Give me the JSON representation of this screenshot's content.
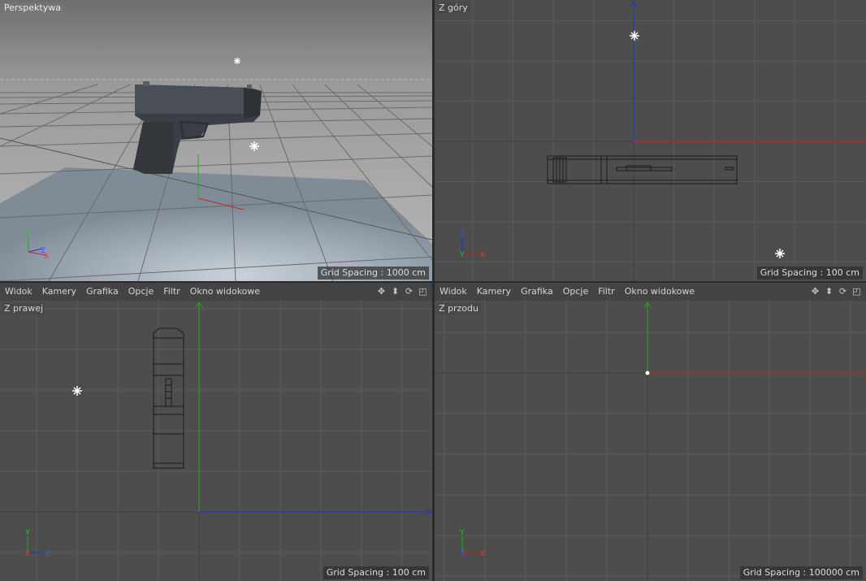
{
  "viewports": {
    "perspective": {
      "label": "Perspektywa",
      "grid_spacing": "Grid Spacing : 1000 cm"
    },
    "top": {
      "label": "Z góry",
      "grid_spacing": "Grid Spacing : 100 cm"
    },
    "right": {
      "label": "Z prawej",
      "grid_spacing": "Grid Spacing : 100 cm"
    },
    "front": {
      "label": "Z przodu",
      "grid_spacing": "Grid Spacing : 100000 cm"
    }
  },
  "menu": {
    "items": [
      "Widok",
      "Kamery",
      "Grafika",
      "Opcje",
      "Filtr",
      "Okno widokowe"
    ],
    "icons": [
      "move-icon",
      "zoom-icon",
      "rotate-icon",
      "maximize-icon"
    ]
  },
  "axis_labels": {
    "x": "X",
    "y": "Y",
    "z": "Z"
  },
  "colors": {
    "x_axis": "#cc2222",
    "y_axis": "#22aa22",
    "z_axis": "#2233cc",
    "viewport_bg": "#4d4d4d",
    "grid": "#5a5a5a"
  }
}
